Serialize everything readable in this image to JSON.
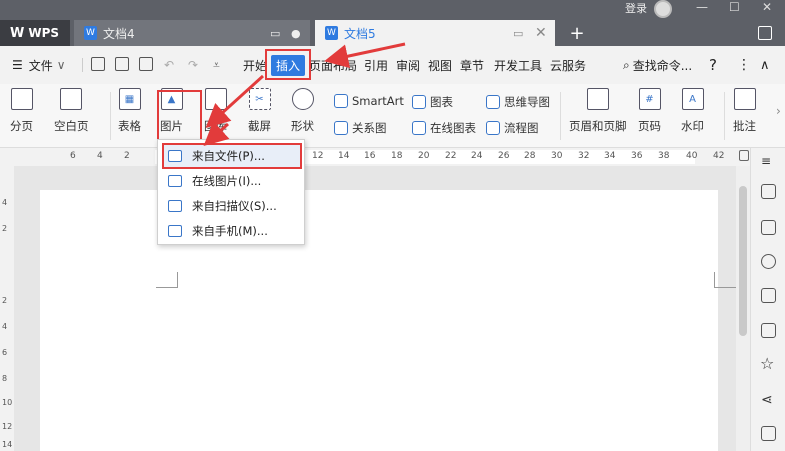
{
  "titlebar": {
    "app_tab": "WPS",
    "tabs": [
      {
        "label": "文档4",
        "active": false
      },
      {
        "label": "文档5",
        "active": true
      }
    ],
    "login_label": "登录"
  },
  "menubar": {
    "file_label": "文件",
    "items": [
      "开始",
      "插入",
      "页面布局",
      "引用",
      "审阅",
      "视图",
      "章节",
      "开发工具",
      "云服务"
    ],
    "search_label": "查找命令..."
  },
  "ribbon": {
    "large_tools": [
      {
        "label": "分页"
      },
      {
        "label": "空白页"
      },
      {
        "label": "表格"
      },
      {
        "label": "图片"
      },
      {
        "label": "图库"
      },
      {
        "label": "截屏"
      },
      {
        "label": "形状"
      },
      {
        "label": "页眉和页脚"
      },
      {
        "label": "页码"
      },
      {
        "label": "水印"
      },
      {
        "label": "批注"
      }
    ],
    "small_tools": [
      {
        "label": "SmartArt"
      },
      {
        "label": "图表"
      },
      {
        "label": "思维导图"
      },
      {
        "label": "关系图"
      },
      {
        "label": "在线图表"
      },
      {
        "label": "流程图"
      }
    ]
  },
  "ruler": {
    "numbers": [
      "6",
      "4",
      "2",
      "2",
      "12",
      "14",
      "16",
      "18",
      "20",
      "22",
      "24",
      "26",
      "28",
      "30",
      "32",
      "34",
      "36",
      "38",
      "40",
      "42"
    ]
  },
  "vruler": {
    "numbers": [
      "4",
      "2",
      "2",
      "4",
      "6",
      "8",
      "10",
      "12",
      "14"
    ]
  },
  "dropdown": {
    "items": [
      {
        "label": "来自文件(P)..."
      },
      {
        "label": "在线图片(I)..."
      },
      {
        "label": "来自扫描仪(S)..."
      },
      {
        "label": "来自手机(M)..."
      }
    ]
  },
  "colors": {
    "accent": "#2f7be0",
    "highlight": "#e23b3b",
    "titlebar": "#5d6067"
  }
}
